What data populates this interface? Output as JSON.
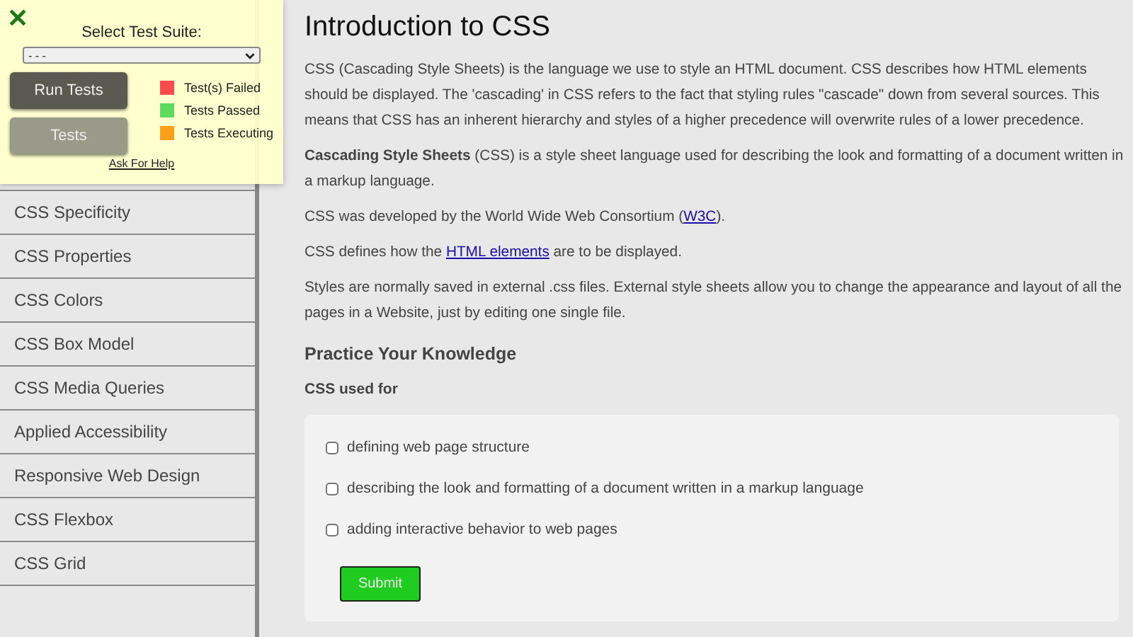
{
  "sidebar": {
    "items": [
      {
        "label": "CSS Specificity",
        "selected": false
      },
      {
        "label": "CSS Properties",
        "selected": false
      },
      {
        "label": "CSS Colors",
        "selected": false
      },
      {
        "label": "CSS Box Model",
        "selected": false
      },
      {
        "label": "CSS Media Queries",
        "selected": false
      },
      {
        "label": "Applied Accessibility",
        "selected": false
      },
      {
        "label": "Responsive Web Design",
        "selected": false
      },
      {
        "label": "CSS Flexbox",
        "selected": false
      },
      {
        "label": "CSS Grid",
        "selected": false
      }
    ]
  },
  "test_panel": {
    "close": "✕",
    "title": "Select Test Suite:",
    "suite_select": {
      "value": "- - -"
    },
    "buttons": [
      {
        "label": "Run Tests",
        "disabled": false
      },
      {
        "label": "Tests",
        "disabled": true
      }
    ],
    "legend": [
      {
        "label": "Test(s) Failed",
        "color": "#ff4b4b"
      },
      {
        "label": "Tests Passed",
        "color": "#5cdb5c"
      },
      {
        "label": "Tests Executing",
        "color": "#ff9f1a"
      }
    ],
    "help_link": "Ask For Help"
  },
  "main": {
    "title": "Introduction to CSS",
    "paragraphs": [
      {
        "parts": [
          {
            "text": "CSS (Cascading Style Sheets) is the language we use to style an HTML document. CSS describes how HTML elements should be displayed. The 'cascading' in CSS refers to the fact that styling rules \"cascade\" down from several sources. This means that CSS has an inherent hierarchy and styles of a higher precedence will overwrite rules of a lower precedence."
          }
        ]
      },
      {
        "parts": [
          {
            "text": "**Cascading Style Sheets** (CSS) is a style sheet language used for describing the look and formatting of a document written in a markup language."
          }
        ]
      },
      {
        "parts": [
          {
            "text": "CSS was developed by the World Wide Web Consortium ("
          },
          {
            "text": "W3C",
            "kind": "link"
          },
          {
            "text": ")."
          }
        ]
      },
      {
        "parts": [
          {
            "text": "CSS defines how the "
          },
          {
            "text": "HTML elements",
            "kind": "link"
          },
          {
            "text": " are to be displayed."
          }
        ]
      },
      {
        "parts": [
          {
            "text": "Styles are normally saved in external .css files. External style sheets allow you to change the appearance and layout of all the pages in a Website, just by editing one single file."
          }
        ]
      }
    ],
    "practice_heading": "Practice Your Knowledge",
    "question": "CSS used for",
    "options": [
      {
        "label": "defining web page structure",
        "checked": false
      },
      {
        "label": "describing the look and formatting of a document written in a markup language",
        "checked": false
      },
      {
        "label": "adding interactive behavior to web pages",
        "checked": false
      }
    ],
    "submit": "Submit"
  }
}
